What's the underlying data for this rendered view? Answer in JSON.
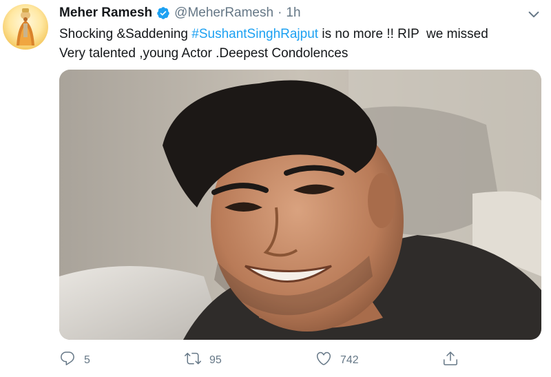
{
  "tweet": {
    "author_name": "Meher Ramesh",
    "handle": "@MeherRamesh",
    "separator": "·",
    "time": "1h",
    "text_line1_before": "Shocking &Saddening ",
    "hashtag": "#SushantSinghRajput",
    "text_line1_after": " is no more !! RIP  we missed",
    "text_line2": "Very talented ,young Actor .Deepest Condolences",
    "reply_count": "5",
    "retweet_count": "95",
    "like_count": "742"
  },
  "icons": {
    "verified": "verified-badge-icon",
    "caret": "chevron-down-icon",
    "reply": "reply-icon",
    "retweet": "retweet-icon",
    "like": "heart-icon",
    "share": "share-icon"
  },
  "colors": {
    "accent": "#1da1f2",
    "secondary_text": "#657786",
    "primary_text": "#14171a"
  }
}
